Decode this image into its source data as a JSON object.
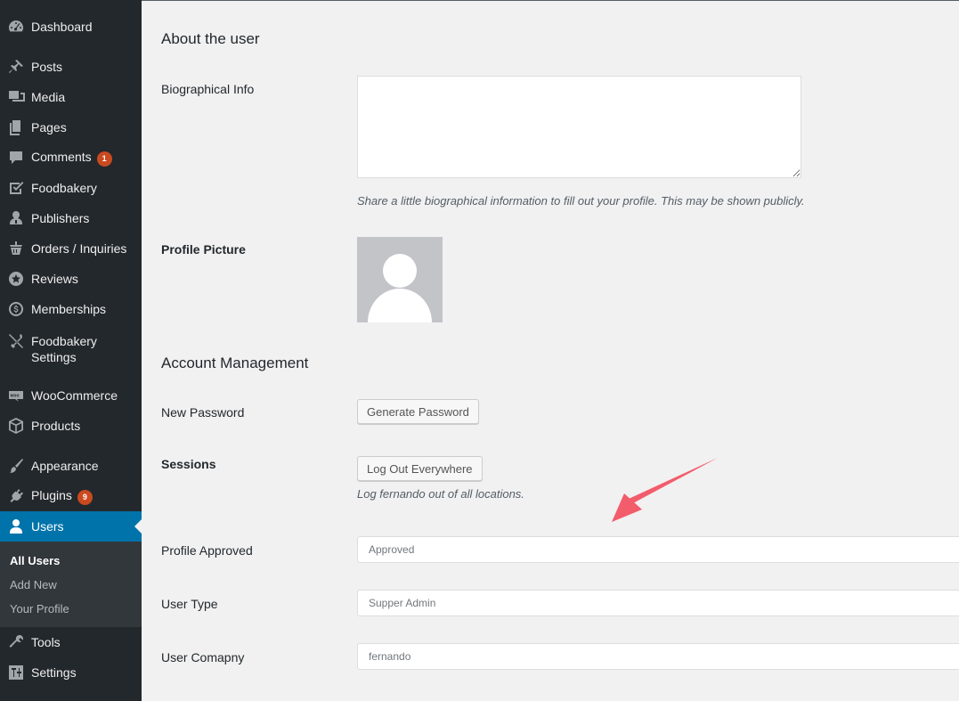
{
  "sidebar": {
    "items": [
      {
        "label": "Dashboard",
        "icon": "dashboard-icon"
      },
      {
        "label": "Posts",
        "icon": "pin-icon"
      },
      {
        "label": "Media",
        "icon": "media-icon"
      },
      {
        "label": "Pages",
        "icon": "pages-icon"
      },
      {
        "label": "Comments",
        "icon": "comment-icon",
        "badge": "1"
      },
      {
        "label": "Foodbakery",
        "icon": "checkbox-icon"
      },
      {
        "label": "Publishers",
        "icon": "publisher-icon"
      },
      {
        "label": "Orders / Inquiries",
        "icon": "basket-icon"
      },
      {
        "label": "Reviews",
        "icon": "star-icon"
      },
      {
        "label": "Memberships",
        "icon": "dollar-icon"
      },
      {
        "label": "Foodbakery Settings",
        "icon": "tools-icon"
      },
      {
        "label": "WooCommerce",
        "icon": "woo-icon"
      },
      {
        "label": "Products",
        "icon": "box-icon"
      },
      {
        "label": "Appearance",
        "icon": "brush-icon"
      },
      {
        "label": "Plugins",
        "icon": "plugin-icon",
        "badge": "9"
      },
      {
        "label": "Users",
        "icon": "user-icon",
        "active": true
      },
      {
        "label": "Tools",
        "icon": "wrench-icon"
      },
      {
        "label": "Settings",
        "icon": "settings-icon"
      }
    ],
    "submenu": [
      {
        "label": "All Users",
        "current": true
      },
      {
        "label": "Add New"
      },
      {
        "label": "Your Profile"
      }
    ]
  },
  "main": {
    "about_heading": "About the user",
    "bio_label": "Biographical Info",
    "bio_value": "",
    "bio_desc": "Share a little biographical information to fill out your profile. This may be shown publicly.",
    "picture_label": "Profile Picture",
    "account_heading": "Account Management",
    "new_password_label": "New Password",
    "generate_password_button": "Generate Password",
    "sessions_label": "Sessions",
    "logout_button": "Log Out Everywhere",
    "logout_desc": "Log fernando out of all locations.",
    "profile_approved_label": "Profile Approved",
    "profile_approved_value": "Approved",
    "user_type_label": "User Type",
    "user_type_value": "Supper Admin",
    "user_company_label": "User Comapny",
    "user_company_value": "fernando"
  },
  "colors": {
    "sidebar_bg": "#23282d",
    "submenu_bg": "#32373c",
    "active_bg": "#0073aa",
    "badge_bg": "#ca4a1f",
    "page_bg": "#f1f1f1",
    "arrow": "#f25c6b"
  }
}
